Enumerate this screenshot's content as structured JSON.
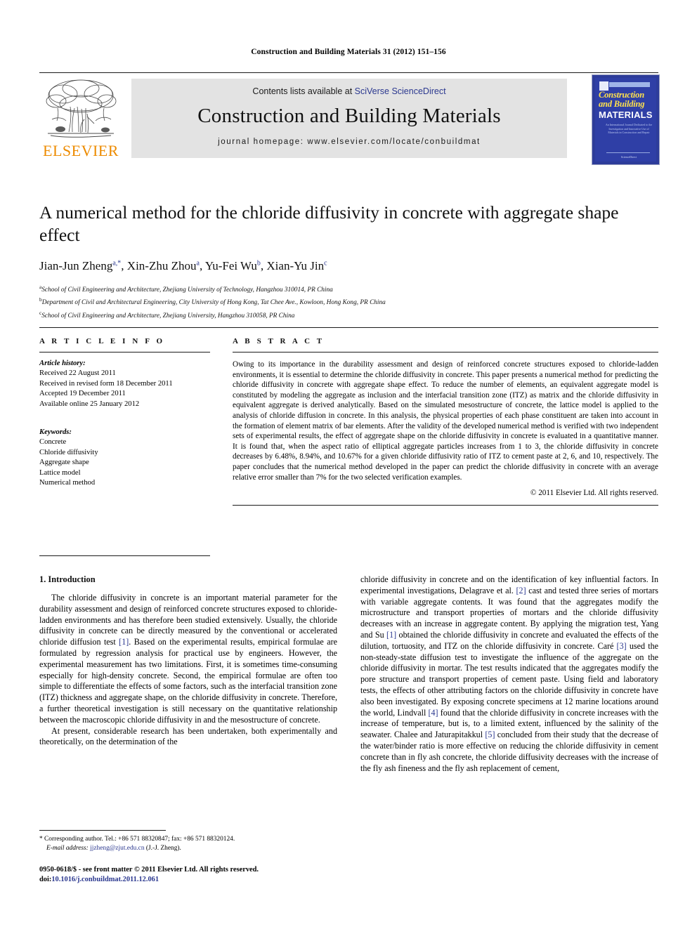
{
  "running_head": "Construction and Building Materials 31 (2012) 151–156",
  "masthead": {
    "contents_prefix": "Contents lists available at ",
    "contents_link": "SciVerse ScienceDirect",
    "journal_title": "Construction and Building Materials",
    "homepage_label": "journal homepage: www.elsevier.com/locate/conbuildmat",
    "publisher_wordmark": "ELSEVIER",
    "cover": {
      "line1": "Construction",
      "line2": "and Building",
      "line3": "MATERIALS",
      "blurb": "An International Journal Dedicated to the Investigation and Innovative Use of Materials in Construction and Repair",
      "footer": "ScienceDirect"
    },
    "colors": {
      "elsevier_orange": "#ED8B00",
      "link_blue": "#2b388f",
      "band_gray": "#e3e3e3",
      "cover_blue": "#2f3fa6",
      "cover_yellow": "#ffe14d"
    }
  },
  "article": {
    "title": "A numerical method for the chloride diffusivity in concrete with aggregate shape effect",
    "authors": [
      {
        "name": "Jian-Jun Zheng",
        "marks": "a,*"
      },
      {
        "name": "Xin-Zhu Zhou",
        "marks": "a"
      },
      {
        "name": "Yu-Fei Wu",
        "marks": "b"
      },
      {
        "name": "Xian-Yu Jin",
        "marks": "c"
      }
    ],
    "affiliations": [
      {
        "mark": "a",
        "text": "School of Civil Engineering and Architecture, Zhejiang University of Technology, Hangzhou 310014, PR China"
      },
      {
        "mark": "b",
        "text": "Department of Civil and Architectural Engineering, City University of Hong Kong, Tat Chee Ave., Kowloon, Hong Kong, PR China"
      },
      {
        "mark": "c",
        "text": "School of Civil Engineering and Architecture, Zhejiang University, Hangzhou 310058, PR China"
      }
    ]
  },
  "article_info": {
    "heading": "A R T I C L E   I N F O",
    "history_label": "Article history:",
    "history": [
      "Received 22 August 2011",
      "Received in revised form 18 December 2011",
      "Accepted 19 December 2011",
      "Available online 25 January 2012"
    ],
    "keywords_label": "Keywords:",
    "keywords": [
      "Concrete",
      "Chloride diffusivity",
      "Aggregate shape",
      "Lattice model",
      "Numerical method"
    ]
  },
  "abstract": {
    "heading": "A B S T R A C T",
    "text": "Owing to its importance in the durability assessment and design of reinforced concrete structures exposed to chloride-ladden environments, it is essential to determine the chloride diffusivity in concrete. This paper presents a numerical method for predicting the chloride diffusivity in concrete with aggregate shape effect. To reduce the number of elements, an equivalent aggregate model is constituted by modeling the aggregate as inclusion and the interfacial transition zone (ITZ) as matrix and the chloride diffusivity in equivalent aggregate is derived analytically. Based on the simulated mesostructure of concrete, the lattice model is applied to the analysis of chloride diffusion in concrete. In this analysis, the physical properties of each phase constituent are taken into account in the formation of element matrix of bar elements. After the validity of the developed numerical method is verified with two independent sets of experimental results, the effect of aggregate shape on the chloride diffusivity in concrete is evaluated in a quantitative manner. It is found that, when the aspect ratio of elliptical aggregate particles increases from 1 to 3, the chloride diffusivity in concrete decreases by 6.48%, 8.94%, and 10.67% for a given chloride diffusivity ratio of ITZ to cement paste at 2, 6, and 10, respectively. The paper concludes that the numerical method developed in the paper can predict the chloride diffusivity in concrete with an average relative error smaller than 7% for the two selected verification examples.",
    "copyright": "© 2011 Elsevier Ltd. All rights reserved."
  },
  "body": {
    "section_heading": "1. Introduction",
    "left_paragraph_1_a": "The chloride diffusivity in concrete is an important material parameter for the durability assessment and design of reinforced concrete structures exposed to chloride-ladden environments and has therefore been studied extensively. Usually, the chloride diffusivity in concrete can be directly measured by the conventional or accelerated chloride diffusion test ",
    "left_paragraph_1_cite": "[1]",
    "left_paragraph_1_b": ". Based on the experimental results, empirical formulae are formulated by regression analysis for practical use by engineers. However, the experimental measurement has two limitations. First, it is sometimes time-consuming especially for high-density concrete. Second, the empirical formulae are often too simple to differentiate the effects of some factors, such as the interfacial transition zone (ITZ) thickness and aggregate shape, on the chloride diffusivity in concrete. Therefore, a further theoretical investigation is still necessary on the quantitative relationship between the macroscopic chloride diffusivity in and the mesostructure of concrete.",
    "left_paragraph_2": "At present, considerable research has been undertaken, both experimentally and theoretically, on the determination of the",
    "right_seg_1": "chloride diffusivity in concrete and on the identification of key influential factors. In experimental investigations, Delagrave et al. ",
    "right_cite_1": "[2]",
    "right_seg_2": " cast and tested three series of mortars with variable aggregate contents. It was found that the aggregates modify the microstructure and transport properties of mortars and the chloride diffusivity decreases with an increase in aggregate content. By applying the migration test, Yang and Su ",
    "right_cite_2": "[1]",
    "right_seg_3": " obtained the chloride diffusivity in concrete and evaluated the effects of the dilution, tortuosity, and ITZ on the chloride diffusivity in concrete. Caré ",
    "right_cite_3": "[3]",
    "right_seg_4": " used the non-steady-state diffusion test to investigate the influence of the aggregate on the chloride diffusivity in mortar. The test results indicated that the aggregates modify the pore structure and transport properties of cement paste. Using field and laboratory tests, the effects of other attributing factors on the chloride diffusivity in concrete have also been investigated. By exposing concrete specimens at 12 marine locations around the world, Lindvall ",
    "right_cite_4": "[4]",
    "right_seg_5": " found that the chloride diffusivity in concrete increases with the increase of temperature, but is, to a limited extent, influenced by the salinity of the seawater. Chalee and Jaturapitakkul ",
    "right_cite_5": "[5]",
    "right_seg_6": " concluded from their study that the decrease of the water/binder ratio is more effective on reducing the chloride diffusivity in cement concrete than in fly ash concrete, the chloride diffusivity decreases with the increase of the fly ash fineness and the fly ash replacement of cement,"
  },
  "footnotes": {
    "corresponding_mark": "*",
    "corresponding": "Corresponding author. Tel.: +86 571 88320847; fax: +86 571 88320124.",
    "email_label": "E-mail address:",
    "email": "jjzheng@zjut.edu.cn",
    "email_owner": "(J.-J. Zheng).",
    "imprint": "0950-0618/$ - see front matter © 2011 Elsevier Ltd. All rights reserved.",
    "doi_label": "doi:",
    "doi": "10.1016/j.conbuildmat.2011.12.061"
  }
}
